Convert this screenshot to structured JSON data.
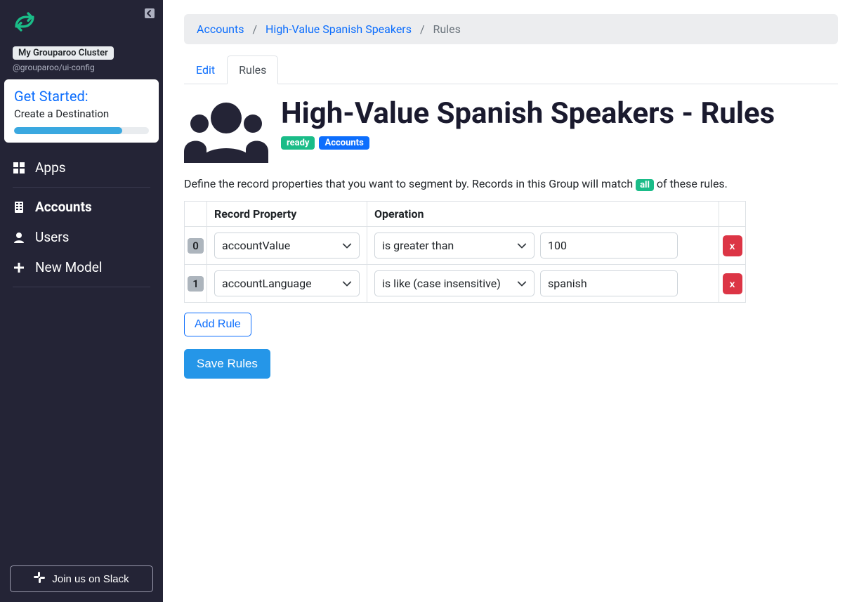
{
  "sidebar": {
    "cluster_name": "My Grouparoo Cluster",
    "cluster_sub": "@grouparoo/ui-config",
    "get_started": {
      "title": "Get Started:",
      "subtitle": "Create a Destination",
      "progress_pct": 80
    },
    "nav": {
      "apps": "Apps",
      "accounts": "Accounts",
      "users": "Users",
      "new_model": "New Model"
    },
    "slack_label": "Join us on Slack"
  },
  "breadcrumb": {
    "items": [
      {
        "label": "Accounts",
        "link": true
      },
      {
        "label": "High-Value Spanish Speakers",
        "link": true
      },
      {
        "label": "Rules",
        "link": false
      }
    ]
  },
  "tabs": {
    "edit": "Edit",
    "rules": "Rules"
  },
  "page": {
    "title": "High-Value Spanish Speakers - Rules",
    "badge_ready": "ready",
    "badge_model": "Accounts",
    "description_pre": "Define the record properties that you want to segment by. Records in this Group will match ",
    "description_badge": "all",
    "description_post": " of these rules."
  },
  "table": {
    "col_property": "Record Property",
    "col_operation": "Operation",
    "rows": [
      {
        "idx": "0",
        "property": "accountValue",
        "operation": "is greater than",
        "value": "100"
      },
      {
        "idx": "1",
        "property": "accountLanguage",
        "operation": "is like (case insensitive)",
        "value": "spanish"
      }
    ],
    "delete_label": "x"
  },
  "buttons": {
    "add_rule": "Add Rule",
    "save_rules": "Save Rules"
  }
}
